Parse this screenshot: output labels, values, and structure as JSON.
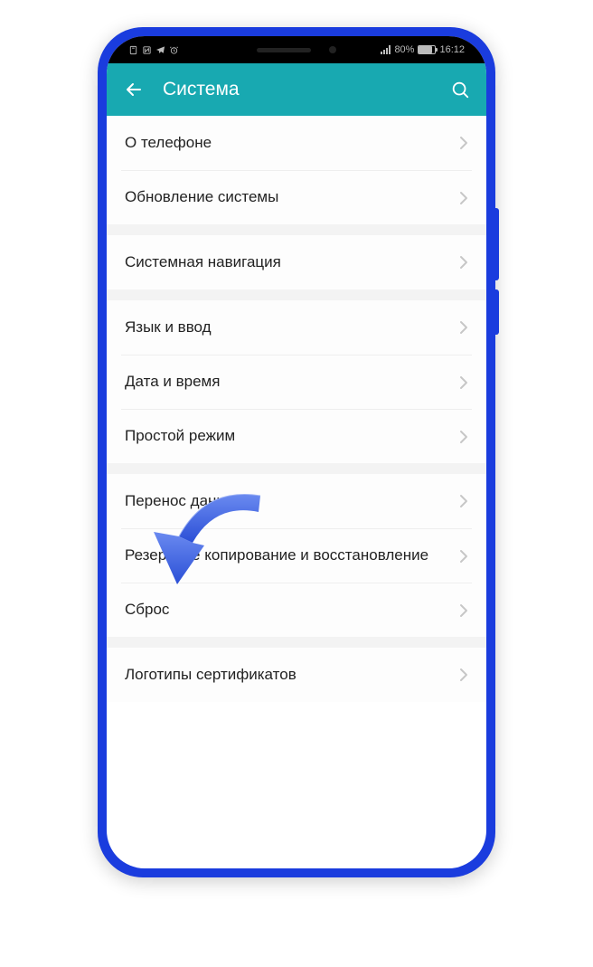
{
  "statusbar": {
    "battery_pct": "80%",
    "time": "16:12"
  },
  "header": {
    "title": "Система"
  },
  "groups": [
    {
      "items": [
        {
          "label": "О телефоне"
        },
        {
          "label": "Обновление системы"
        }
      ]
    },
    {
      "items": [
        {
          "label": "Системная навигация"
        }
      ]
    },
    {
      "items": [
        {
          "label": "Язык и ввод"
        },
        {
          "label": "Дата и время"
        },
        {
          "label": "Простой режим"
        }
      ]
    },
    {
      "items": [
        {
          "label": "Перенос данных"
        },
        {
          "label": "Резервное копирование и восстановление"
        },
        {
          "label": "Сброс"
        }
      ]
    },
    {
      "items": [
        {
          "label": "Логотипы сертификатов"
        }
      ]
    }
  ]
}
